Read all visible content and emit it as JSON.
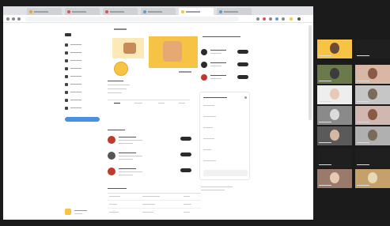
{
  "colors": {
    "brand_yellow": "#f6c344",
    "dark_button": "#2b2b2b",
    "blue_button": "#4a90e2",
    "red_badge": "#c0392b",
    "zoom_bg": "#1b1b1b"
  },
  "browser": {
    "tabs": [
      {
        "color": "#e8a33d"
      },
      {
        "color": "#d9534f"
      },
      {
        "color": "#d9534f"
      },
      {
        "color": "#5b9bd5"
      },
      {
        "color": "#f6c344"
      },
      {
        "color": "#5b9bd5"
      }
    ],
    "sidebar": {
      "items": [
        {
          "icon": "home-icon"
        },
        {
          "icon": "search-icon"
        },
        {
          "icon": "explore-icon"
        },
        {
          "icon": "reels-icon"
        },
        {
          "icon": "message-icon"
        },
        {
          "icon": "heart-icon"
        },
        {
          "icon": "plus-icon"
        },
        {
          "icon": "chart-icon"
        },
        {
          "icon": "user-icon"
        }
      ]
    },
    "profile": {
      "stats": [
        "",
        "",
        ""
      ]
    },
    "right_panel": {
      "suggestions": [
        {
          "avatar_color": "#2b2b2b"
        },
        {
          "avatar_color": "#2b2b2b"
        },
        {
          "avatar_color": "#c0392b"
        }
      ]
    },
    "feed": {
      "items": [
        {
          "avatar_color": "#c0392b"
        },
        {
          "avatar_color": "#555"
        },
        {
          "avatar_color": "#c0392b"
        }
      ]
    }
  },
  "zoom": {
    "tiles": [
      {
        "bg": "#f6c344",
        "face": "#6b4a3a"
      },
      {
        "bg": "#1f1f1f",
        "face": "#1f1f1f"
      },
      {
        "bg": "#6a7a4a",
        "face": "#3c3c3c"
      },
      {
        "bg": "#d9b7a5",
        "face": "#8a5a44"
      },
      {
        "bg": "#eee",
        "face": "#e8c9b5"
      },
      {
        "bg": "#c6c6c6",
        "face": "#7a6a5a"
      },
      {
        "bg": "#8a8a8a",
        "face": "#dcdcdc"
      },
      {
        "bg": "#d0b8b0",
        "face": "#8a5a44"
      },
      {
        "bg": "#5a5a5a",
        "face": "#d7b9a0"
      },
      {
        "bg": "#b0b0b0",
        "face": "#7a6a5a"
      },
      {
        "bg": "#1f1f1f",
        "face": "#1f1f1f"
      },
      {
        "bg": "#1f1f1f",
        "face": "#1f1f1f"
      },
      {
        "bg": "#9a7a6a",
        "face": "#e8c9b5"
      },
      {
        "bg": "#c5a06a",
        "face": "#e8d9b5"
      }
    ]
  }
}
